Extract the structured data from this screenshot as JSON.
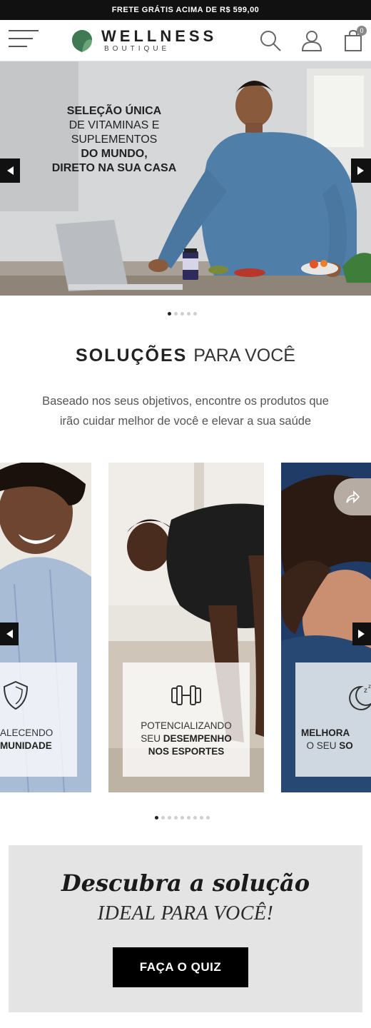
{
  "promo": {
    "text": "FRETE GRÁTIS ACIMA DE R$ 599,00"
  },
  "header": {
    "logo_title": "WELLNESS",
    "logo_subtitle": "BOUTIQUE",
    "cart_count": "0",
    "icons": [
      "menu-icon",
      "search-icon",
      "user-icon",
      "shopping-bag-icon"
    ]
  },
  "hero": {
    "line1": "SELEÇÃO ÚNICA",
    "line2": "DE VITAMINAS E",
    "line3": "SUPLEMENTOS",
    "line4": "DO MUNDO,",
    "line5": "DIRETO NA SUA CASA",
    "slide_count": 5,
    "active_slide": 1
  },
  "solutions": {
    "title_bold": "SOLUÇÕES",
    "title_light": "PARA VOCÊ",
    "subtitle_line1": "Baseado nos seus objetivos, encontre os produtos que",
    "subtitle_line2": "irão cuidar melhor de você e elevar a sua saúde",
    "cards": [
      {
        "line1": "ALECENDO",
        "line2": "MUNIDADE",
        "icon": "shield-icon"
      },
      {
        "line1": "POTENCIALIZANDO",
        "line2": "SEU",
        "line2_bold": "DESEMPENHO",
        "line3": "NOS ESPORTES",
        "icon": "dumbbell-icon"
      },
      {
        "line1": "MELHORA",
        "line2": "O SEU",
        "line2_bold": "SO",
        "icon": "moon-sleep-icon"
      }
    ],
    "slide_count": 9,
    "active_slide": 1
  },
  "quiz": {
    "title": "Descubra a solução",
    "subtitle": "IDEAL PARA VOCÊ!",
    "button": "FAÇA O QUIZ"
  },
  "colors": {
    "promo_bg": "#111111",
    "quiz_bg": "#e4e4e4",
    "button_bg": "#000000",
    "logo_green": "#6aa57a"
  }
}
